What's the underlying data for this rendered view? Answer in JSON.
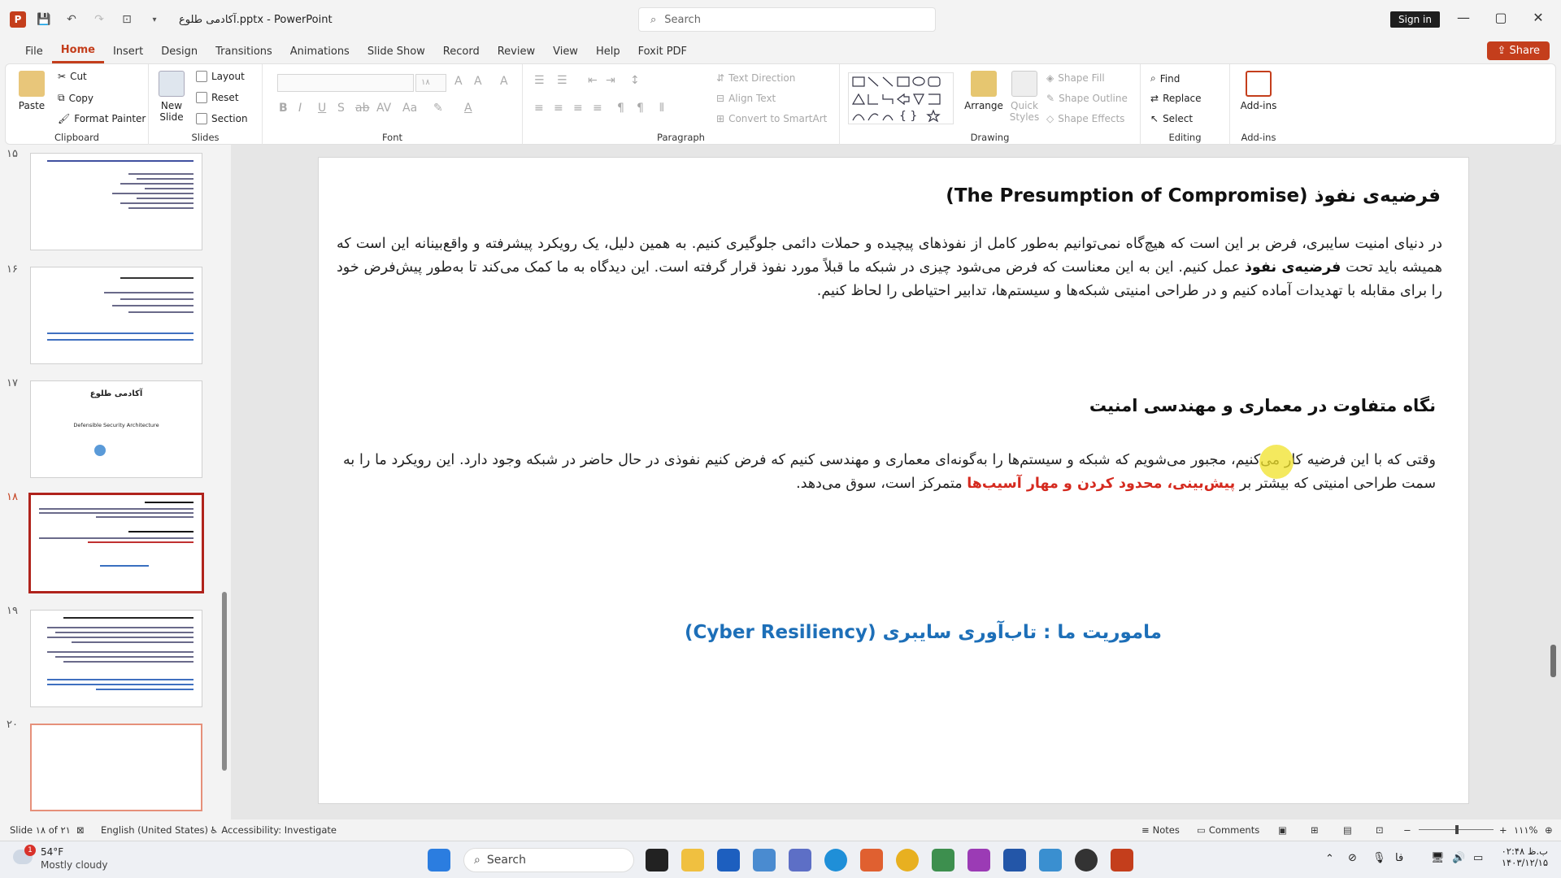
{
  "window": {
    "title": "آکادمی طلوع.pptx  -  PowerPoint",
    "search_placeholder": "Search",
    "signin_label": "Sign in",
    "share_label": "Share"
  },
  "menu": {
    "tabs": [
      "File",
      "Home",
      "Insert",
      "Design",
      "Transitions",
      "Animations",
      "Slide Show",
      "Record",
      "Review",
      "View",
      "Help",
      "Foxit PDF"
    ]
  },
  "ribbon": {
    "clipboard": {
      "label": "Clipboard",
      "paste": "Paste",
      "cut": "Cut",
      "copy": "Copy",
      "format_painter": "Format Painter"
    },
    "slides": {
      "label": "Slides",
      "new_slide": "New Slide",
      "layout": "Layout",
      "reset": "Reset",
      "section": "Section"
    },
    "font": {
      "label": "Font",
      "size": "۱۸"
    },
    "paragraph": {
      "label": "Paragraph",
      "text_direction": "Text Direction",
      "align_text": "Align Text",
      "convert_smartart": "Convert to SmartArt"
    },
    "drawing": {
      "label": "Drawing",
      "arrange": "Arrange",
      "quick_styles": "Quick Styles",
      "shape_fill": "Shape Fill",
      "shape_outline": "Shape Outline",
      "shape_effects": "Shape Effects"
    },
    "editing": {
      "label": "Editing",
      "find": "Find",
      "replace": "Replace",
      "select": "Select"
    },
    "addins": {
      "label": "Add-ins",
      "addins_btn": "Add-ins"
    }
  },
  "thumbnails": {
    "numbers": [
      "۱۵",
      "۱۶",
      "۱۷",
      "۱۸",
      "۱۹",
      "۲۰"
    ],
    "slide17_title": "آکادمی طلوع",
    "slide17_sub": "Defensible Security Architecture",
    "selected_index": 4
  },
  "slide": {
    "title1": "فرضیه‌ی نفوذ (The Presumption of Compromise)",
    "para1_a": "در دنیای امنیت سایبری، فرض بر این است که هیچ‌گاه نمی‌توانیم به‌طور کامل از نفوذهای پیچیده و حملات دائمی جلوگیری کنیم. به همین دلیل، یک رویکرد پیشرفته و واقع‌بینانه این است که همیشه باید تحت ",
    "para1_bold": "فرضیه‌ی نفوذ",
    "para1_b": " عمل کنیم. این به این معناست که فرض می‌شود چیزی در شبکه ما قبلاً مورد نفوذ قرار گرفته است. این دیدگاه به ما کمک می‌کند تا به‌طور پیش‌فرض خود را برای مقابله با تهدیدات آماده کنیم و در طراحی امنیتی شبکه‌ها و سیستم‌ها، تدابیر احتیاطی را لحاظ کنیم.",
    "title2": "نگاه متفاوت در معماری و مهندسی امنیت",
    "para2_a": "وقتی که با این فرضیه کار می‌کنیم، مجبور می‌شویم که شبکه و سیستم‌ها را به‌گونه‌ای معماری و مهندسی کنیم که فرض کنیم نفوذی در حال حاضر در شبکه وجود دارد. این رویکرد ما را به سمت طراحی امنیتی که بیشتر بر ",
    "para2_red": "پیش‌بینی، محدود کردن و مهار آسیب‌ها",
    "para2_b": " متمرکز است، سوق می‌دهد.",
    "title3": "ماموریت ما : تاب‌آوری سایبری (Cyber Resiliency)"
  },
  "status": {
    "slide_info": "Slide ۱۸ of ۲۱",
    "language": "English (United States)",
    "accessibility": "Accessibility: Investigate",
    "notes": "Notes",
    "comments": "Comments",
    "zoom": "۱۱۱%"
  },
  "taskbar": {
    "temp": "54°F",
    "weather": "Mostly cloudy",
    "badge": "1",
    "search": "Search",
    "time": "۰۲:۴۸ ب.ظ",
    "date": "۱۴۰۳/۱۲/۱۵",
    "lang": "فا"
  }
}
